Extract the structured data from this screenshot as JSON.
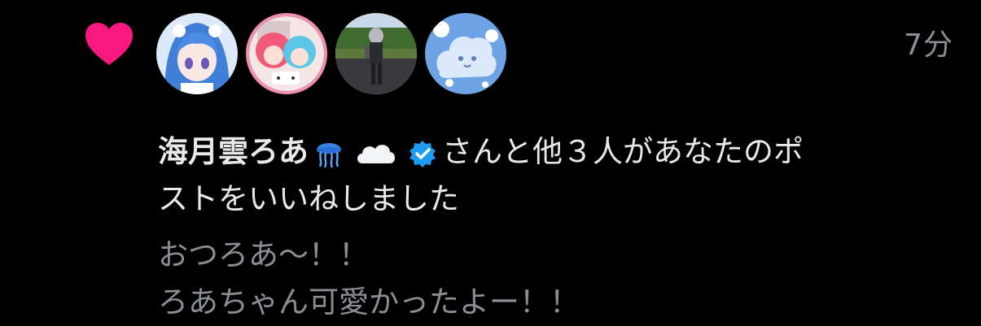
{
  "notification": {
    "type_icon": "heart-icon",
    "time": "7分",
    "actor_name": "海月雲ろあ",
    "actor_emojis": [
      "jellyfish-emoji",
      "cloud-emoji"
    ],
    "actor_verified": true,
    "action_text_line1": "さんと他３人があなたのポ",
    "action_text_line2": "ストをいいねしました",
    "post_lines": [
      "おつろあ〜！！",
      "ろあちゃん可愛かったよー！！"
    ],
    "avatars": [
      {
        "name": "avatar-blue-hair-character"
      },
      {
        "name": "avatar-figures-pink-blue"
      },
      {
        "name": "avatar-figure-outdoor"
      },
      {
        "name": "avatar-cloud-creature"
      }
    ]
  },
  "colors": {
    "background": "#000000",
    "heart": "#f91880",
    "text_primary": "#e7e9ea",
    "text_secondary": "#8b8f95",
    "verified": "#1d9bf0"
  }
}
